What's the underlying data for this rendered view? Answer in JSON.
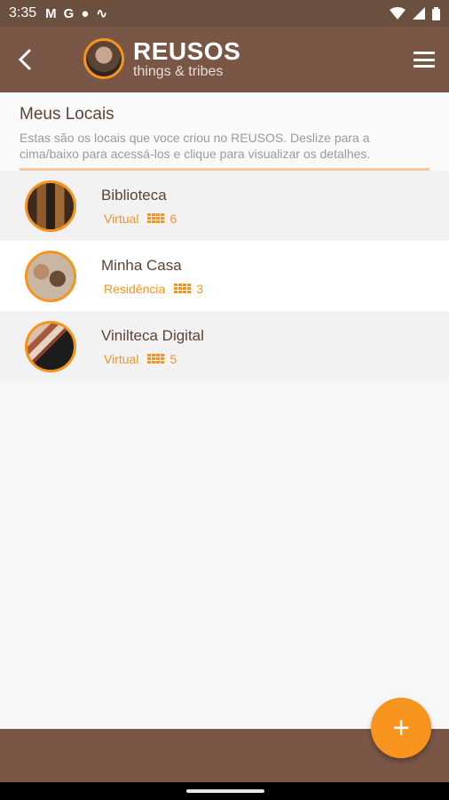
{
  "status_bar": {
    "time": "3:35",
    "notification_icons": [
      "gmail-icon",
      "google-icon",
      "globe-icon",
      "signal-wave-icon"
    ],
    "right_icons": [
      "wifi-icon",
      "cell-signal-icon",
      "battery-icon"
    ]
  },
  "app_bar": {
    "brand_name": "REUSOS",
    "brand_tagline": "things & tribes",
    "back_icon": "back-arrow-icon",
    "menu_icon": "hamburger-menu-icon"
  },
  "header": {
    "title": "Meus Locais",
    "description": "Estas são os locais que voce criou no REUSOS. Deslize para a cima/baixo para acessá-los e clique para visualizar os detalhes."
  },
  "locations": [
    {
      "name": "Biblioteca",
      "type": "Virtual",
      "count": "6"
    },
    {
      "name": "Minha Casa",
      "type": "Residência",
      "count": "3"
    },
    {
      "name": "Vinilteca Digital",
      "type": "Virtual",
      "count": "5"
    }
  ],
  "fab": {
    "label": "+"
  },
  "colors": {
    "brand_brown": "#795646",
    "accent_orange": "#f7941d",
    "text_brown": "#5b4436"
  }
}
